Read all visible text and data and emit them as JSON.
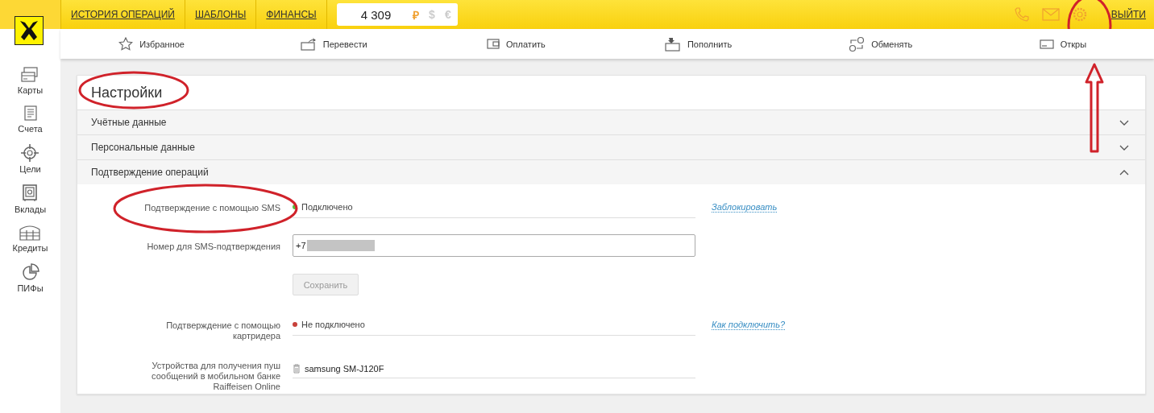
{
  "top_nav": [
    {
      "label": "ИСТОРИЯ ОПЕРАЦИЙ"
    },
    {
      "label": "ШАБЛОНЫ"
    },
    {
      "label": "ФИНАНСЫ"
    }
  ],
  "balance": {
    "amount": "4 309",
    "currencies": [
      {
        "symbol": "₽",
        "selected": true
      },
      {
        "symbol": "$",
        "selected": false
      },
      {
        "symbol": "€",
        "selected": false
      }
    ]
  },
  "logout": "ВЫЙТИ",
  "actions": [
    {
      "label": "Избранное"
    },
    {
      "label": "Перевести"
    },
    {
      "label": "Оплатить"
    },
    {
      "label": "Пополнить"
    },
    {
      "label": "Обменять"
    },
    {
      "label": "Откры"
    }
  ],
  "sidebar": {
    "items": [
      {
        "label": "Карты"
      },
      {
        "label": "Счета"
      },
      {
        "label": "Цели"
      },
      {
        "label": "Вклады"
      },
      {
        "label": "Кредиты"
      },
      {
        "label": "ПИФы"
      }
    ]
  },
  "settings": {
    "title": "Настройки",
    "sections": [
      {
        "title": "Учётные данные",
        "expanded": false
      },
      {
        "title": "Персональные данные",
        "expanded": false
      },
      {
        "title": "Подтверждение операций",
        "expanded": true,
        "rows": [
          {
            "kind": "status",
            "label": "Подтверждение с помощью SMS",
            "status": "Подключено",
            "connected": true,
            "link": "Заблокировать"
          },
          {
            "kind": "input",
            "label": "Номер для SMS-подтверждения",
            "value": "+7"
          },
          {
            "kind": "button",
            "button": "Сохранить",
            "disabled": true
          },
          {
            "kind": "status",
            "label": "Подтверждение с помощью картридера",
            "status": "Не подключено",
            "connected": false,
            "link": "Как подключить?"
          },
          {
            "kind": "device",
            "label": "Устройства для получения пуш сообщений в мобильном банке Raiffeisen Online",
            "device": "samsung SM-J120F"
          }
        ]
      }
    ]
  }
}
